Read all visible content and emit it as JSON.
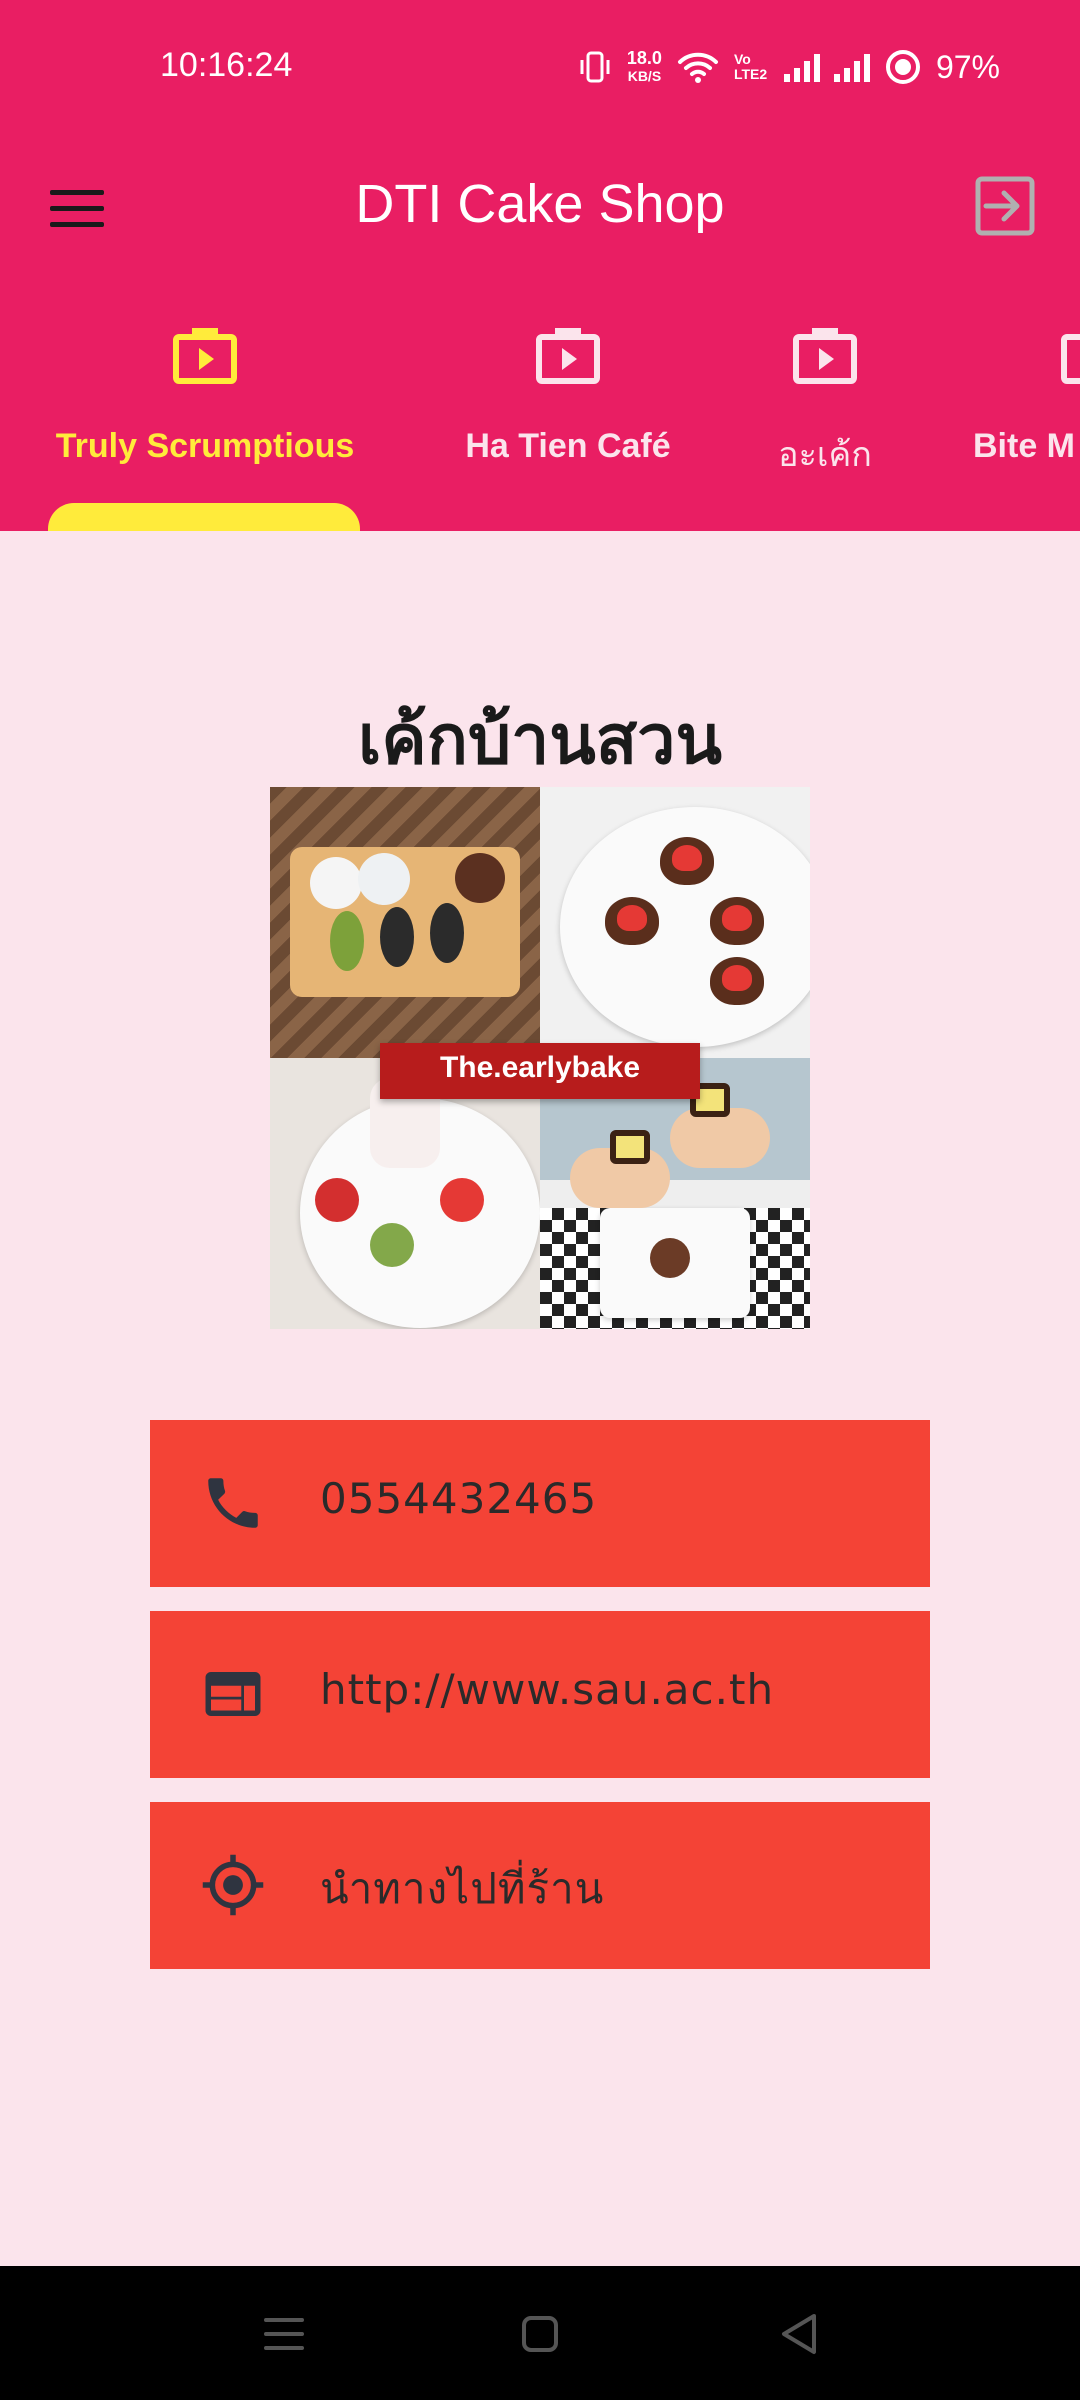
{
  "status_bar": {
    "time": "10:16:24",
    "net_speed_value": "18.0",
    "net_speed_unit": "KB/S",
    "volte": "Vo LTE2",
    "battery": "97%"
  },
  "app_bar": {
    "title": "DTI Cake Shop",
    "menu_icon": "menu-icon",
    "logout_icon": "logout-icon"
  },
  "tabs": [
    {
      "label": "Truly Scrumptious",
      "icon": "shop-video-icon",
      "active": true
    },
    {
      "label": "Ha Tien Café",
      "icon": "shop-video-icon",
      "active": false
    },
    {
      "label": "อะเค้ก",
      "icon": "shop-video-icon",
      "active": false
    },
    {
      "label": "Bite M",
      "icon": "shop-video-icon",
      "active": false
    }
  ],
  "shop": {
    "name": "เค้กบ้านสวน",
    "image_banner": "The.earlybake",
    "phone": "0554432465",
    "website": "http://www.sau.ac.th",
    "directions": "นำทางไปที่ร้าน"
  },
  "colors": {
    "primary": "#e91e63",
    "accent": "#ffeb3b",
    "background": "#fbe4ec",
    "button": "#f44336"
  }
}
